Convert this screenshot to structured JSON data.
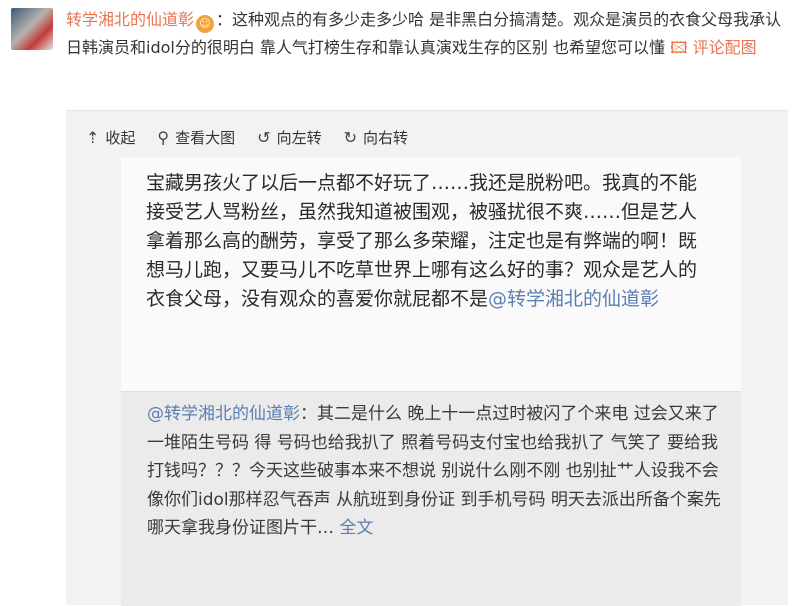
{
  "comment": {
    "username": "转学湘北的仙道彰",
    "badge_icon": "smiley-face-icon",
    "text": "：这种观点的有多少走多少哈 是非黑白分搞清楚。观众是演员的衣食父母我承认 日韩演员和idol分的很明白 靠人气打榜生存和靠认真演戏生存的区别 也希望您可以懂",
    "reply_label": "评论配图"
  },
  "toolbar": {
    "collapse_label": "收起",
    "view_large_label": "查看大图",
    "rotate_left_label": "向左转",
    "rotate_right_label": "向右转"
  },
  "post": {
    "text": "宝藏男孩火了以后一点都不好玩了……我还是脱粉吧。我真的不能接受艺人骂粉丝，虽然我知道被围观，被骚扰很不爽……但是艺人拿着那么高的酬劳，享受了那么多荣耀，注定也是有弊端的啊！既想马儿跑，又要马儿不吃草世界上哪有这么好的事？观众是艺人的衣食父母，没有观众的喜爱你就屁都不是",
    "mention": "@转学湘北的仙道彰"
  },
  "quote": {
    "mention": "@转学湘北的仙道彰",
    "text": "：其二是什么 晚上十一点过时被闪了个来电 过会又来了一堆陌生号码 得 号码也给我扒了 照着号码支付宝也给我扒了 气笑了 要给我打钱吗？？？今天这些破事本来不想说 别说什么刚不刚 也别扯艹人设我不会像你们idol那样忍气吞声 从航班到身份证 到手机号码 明天去派出所备个案先 哪天拿我身份证图片干…",
    "more_label": "全文"
  }
}
